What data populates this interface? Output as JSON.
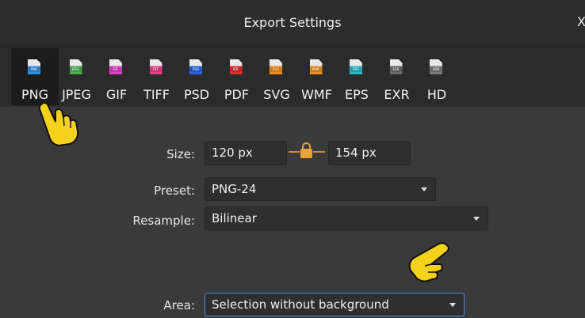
{
  "window": {
    "title": "Export Settings",
    "close_glyph": "X"
  },
  "formats": [
    {
      "label": "PNG",
      "badge": "PNG",
      "color": "#2f8fe0",
      "active": true
    },
    {
      "label": "JPEG",
      "badge": "JPEG",
      "color": "#4caf50",
      "active": false
    },
    {
      "label": "GIF",
      "badge": "GIF",
      "color": "#e040c8",
      "active": false
    },
    {
      "label": "TIFF",
      "badge": "TIFF",
      "color": "#e8408a",
      "active": false
    },
    {
      "label": "PSD",
      "badge": "PSD",
      "color": "#2b64e0",
      "active": false
    },
    {
      "label": "PDF",
      "badge": "PDF",
      "color": "#e0312f",
      "active": false
    },
    {
      "label": "SVG",
      "badge": "SVG",
      "color": "#ef8a1c",
      "active": false
    },
    {
      "label": "WMF",
      "badge": "WMF",
      "color": "#ec8f2a",
      "active": false
    },
    {
      "label": "EPS",
      "badge": "EPS",
      "color": "#2cb8c8",
      "active": false
    },
    {
      "label": "EXR",
      "badge": "EXR",
      "color": "#6b6b6b",
      "active": false
    },
    {
      "label": "HD",
      "badge": "HDR",
      "color": "#7a7a7a",
      "active": false
    }
  ],
  "form": {
    "size_label": "Size:",
    "width_value": "120 px",
    "height_value": "154 px",
    "preset_label": "Preset:",
    "preset_value": "PNG-24",
    "resample_label": "Resample:",
    "resample_value": "Bilinear",
    "area_label": "Area:",
    "area_value": "Selection without background"
  },
  "icons": {
    "lock": "lock-icon",
    "pointer": "pointing-hand-icon"
  },
  "colors": {
    "accent": "#4a90e2",
    "lock": "#e8a43a",
    "hand": "#f5d21a"
  }
}
